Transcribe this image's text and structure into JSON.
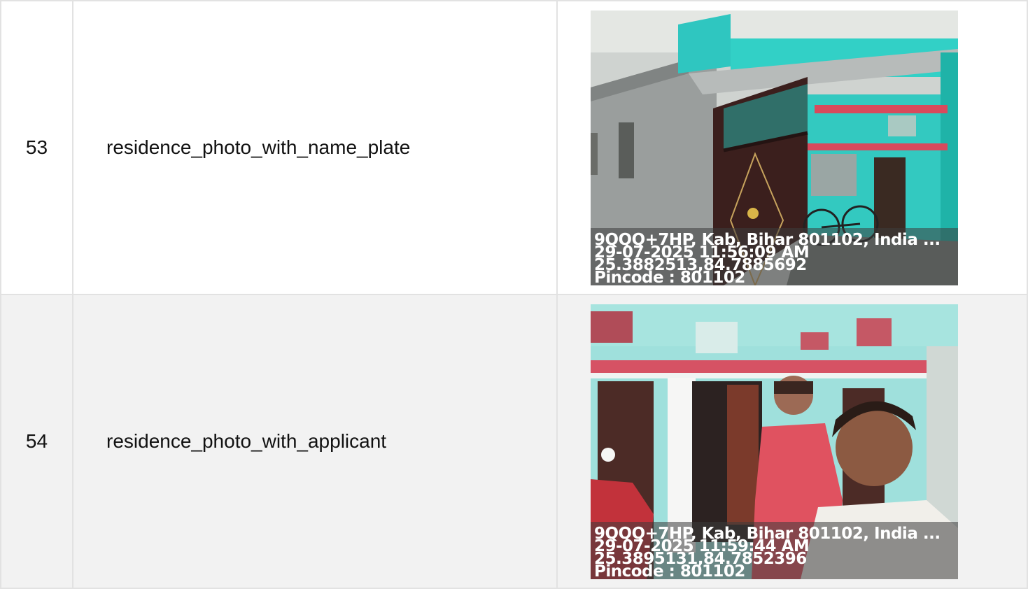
{
  "rows": [
    {
      "number": "53",
      "label": "residence_photo_with_name_plate",
      "photo_icon": "house-gate-photo",
      "stamp": {
        "address": "9QQQ+7HP, Kab, Bihar 801102, India ...",
        "datetime": "29-07-2025 11:56:09 AM",
        "coords": "25.3882513,84.7885692",
        "pincode": "Pincode : 801102"
      }
    },
    {
      "number": "54",
      "label": "residence_photo_with_applicant",
      "photo_icon": "selfie-applicant-photo",
      "stamp": {
        "address": "9QQQ+7HP, Kab, Bihar 801102, India ...",
        "datetime": "29-07-2025 11:59:44 AM",
        "coords": "25.3895131,84.7852396",
        "pincode": "Pincode : 801102"
      }
    }
  ]
}
